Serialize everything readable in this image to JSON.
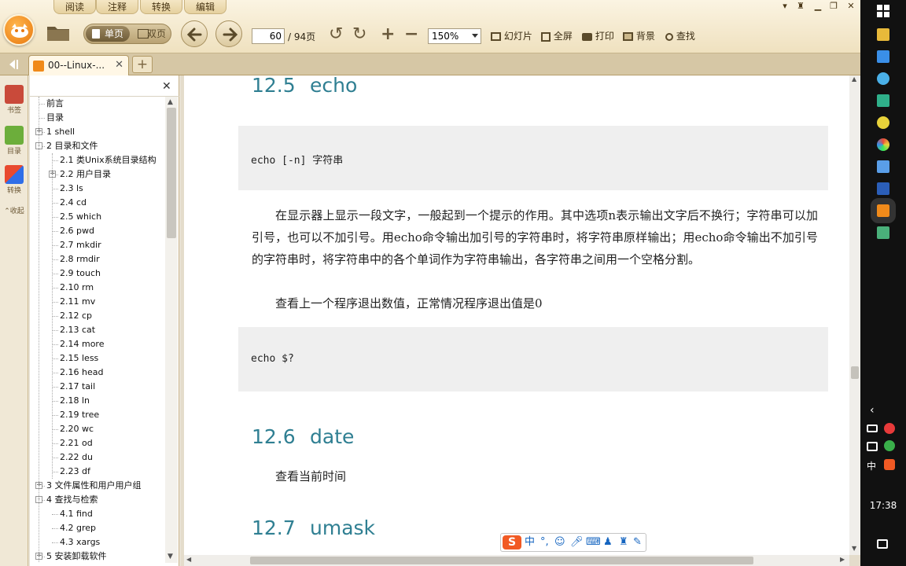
{
  "menu_tabs": [
    "阅读",
    "注释",
    "转换",
    "编辑"
  ],
  "toolbar": {
    "single_page": "单页",
    "double_page": "双页",
    "current_page": "60",
    "total_pages": "/ 94页",
    "zoom": "150%",
    "slideshow": "幻灯片",
    "fullscreen": "全屏",
    "print": "打印",
    "background": "背景",
    "search": "查找"
  },
  "tabs": {
    "doc_tab": "00--Linux-..."
  },
  "sidebar": {
    "bookmark": "书签",
    "outline": "目录",
    "convert": "转换",
    "collapse": "收起"
  },
  "outline": [
    {
      "label": "前言",
      "level": 0,
      "expander": ""
    },
    {
      "label": "目录",
      "level": 0,
      "expander": ""
    },
    {
      "label": "1 shell",
      "level": 0,
      "expander": "+"
    },
    {
      "label": "2 目录和文件",
      "level": 0,
      "expander": "-"
    },
    {
      "label": "2.1 类Unix系统目录结构",
      "level": 1,
      "expander": ""
    },
    {
      "label": "2.2 用户目录",
      "level": 1,
      "expander": "+"
    },
    {
      "label": "2.3 ls",
      "level": 1,
      "expander": ""
    },
    {
      "label": "2.4 cd",
      "level": 1,
      "expander": ""
    },
    {
      "label": "2.5 which",
      "level": 1,
      "expander": ""
    },
    {
      "label": "2.6 pwd",
      "level": 1,
      "expander": ""
    },
    {
      "label": "2.7 mkdir",
      "level": 1,
      "expander": ""
    },
    {
      "label": "2.8 rmdir",
      "level": 1,
      "expander": ""
    },
    {
      "label": "2.9 touch",
      "level": 1,
      "expander": ""
    },
    {
      "label": "2.10 rm",
      "level": 1,
      "expander": ""
    },
    {
      "label": "2.11 mv",
      "level": 1,
      "expander": ""
    },
    {
      "label": "2.12 cp",
      "level": 1,
      "expander": ""
    },
    {
      "label": "2.13 cat",
      "level": 1,
      "expander": ""
    },
    {
      "label": "2.14 more",
      "level": 1,
      "expander": ""
    },
    {
      "label": "2.15 less",
      "level": 1,
      "expander": ""
    },
    {
      "label": "2.16 head",
      "level": 1,
      "expander": ""
    },
    {
      "label": "2.17 tail",
      "level": 1,
      "expander": ""
    },
    {
      "label": "2.18 ln",
      "level": 1,
      "expander": ""
    },
    {
      "label": "2.19 tree",
      "level": 1,
      "expander": ""
    },
    {
      "label": "2.20 wc",
      "level": 1,
      "expander": ""
    },
    {
      "label": "2.21 od",
      "level": 1,
      "expander": ""
    },
    {
      "label": "2.22 du",
      "level": 1,
      "expander": ""
    },
    {
      "label": "2.23 df",
      "level": 1,
      "expander": ""
    },
    {
      "label": "3 文件属性和用户用户组",
      "level": 0,
      "expander": "+"
    },
    {
      "label": "4 查找与检索",
      "level": 0,
      "expander": "-"
    },
    {
      "label": "4.1 find",
      "level": 1,
      "expander": ""
    },
    {
      "label": "4.2 grep",
      "level": 1,
      "expander": ""
    },
    {
      "label": "4.3 xargs",
      "level": 1,
      "expander": ""
    },
    {
      "label": "5 安装卸载软件",
      "level": 0,
      "expander": "+"
    }
  ],
  "document": {
    "sec1_num": "12.5",
    "sec1_title": "echo",
    "code1": "echo [-n] 字符串",
    "para1": "在显示器上显示一段文字，一般起到一个提示的作用。其中选项n表示输出文字后不换行；字符串可以加引号，也可以不加引号。用echo命令输出加引号的字符串时，将字符串原样输出；用echo命令输出不加引号的字符串时，将字符串中的各个单词作为字符串输出，各字符串之间用一个空格分割。",
    "para2": "查看上一个程序退出数值，正常情况程序退出值是0",
    "code2": "echo $?",
    "sec2_num": "12.6",
    "sec2_title": "date",
    "para3": "查看当前时间",
    "sec3_num": "12.7",
    "sec3_title": "umask"
  },
  "ime": {
    "mode": "中",
    "punct": "°,"
  },
  "taskbar": {
    "clock": "17:38",
    "lang": "中"
  }
}
